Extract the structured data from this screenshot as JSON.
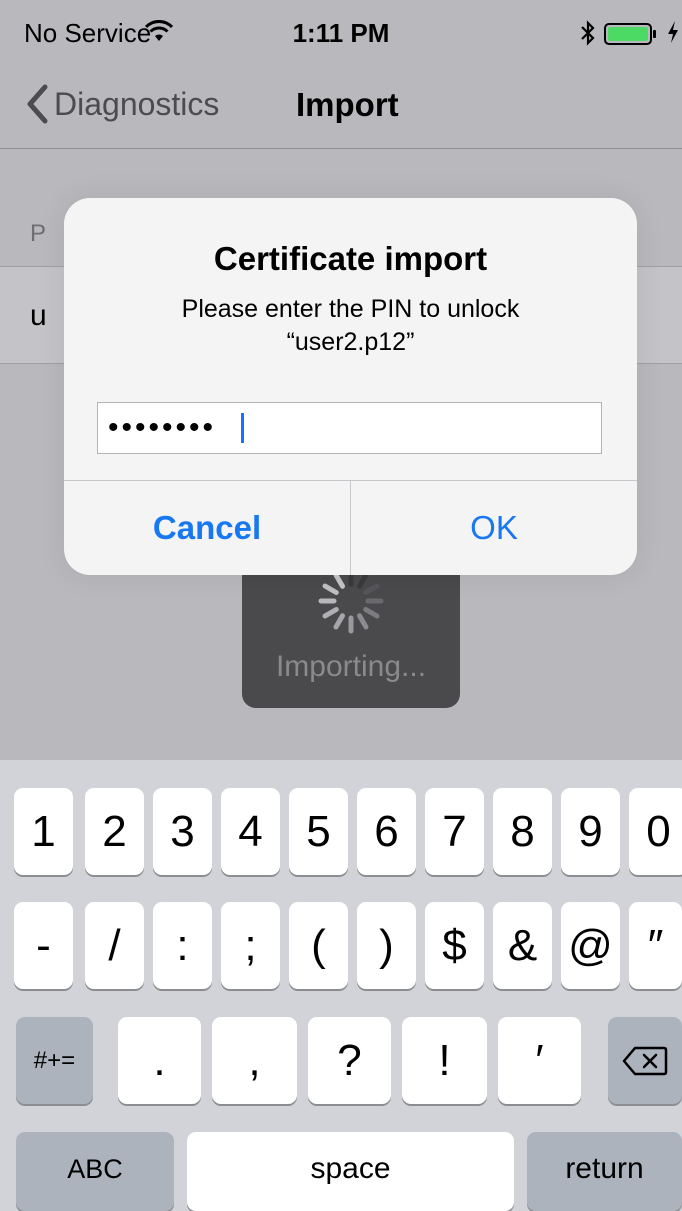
{
  "status_bar": {
    "carrier": "No Service",
    "time": "1:11 PM"
  },
  "nav": {
    "back_label": "Diagnostics",
    "title": "Import"
  },
  "background_list": {
    "section_header": "P",
    "cell_text": "u"
  },
  "alert": {
    "title": "Certificate import",
    "message_line1": "Please enter the PIN to unlock",
    "message_line2": "“user2.p12”",
    "pin_value": "••••••••",
    "cancel_label": "Cancel",
    "ok_label": "OK"
  },
  "hud": {
    "label": "Importing..."
  },
  "keyboard": {
    "row1": [
      "1",
      "2",
      "3",
      "4",
      "5",
      "6",
      "7",
      "8",
      "9",
      "0"
    ],
    "row2": [
      "-",
      "/",
      ":",
      ";",
      "(",
      ")",
      "$",
      "&",
      "@",
      "″"
    ],
    "more_symbols_label": "#+=",
    "row3": [
      ".",
      ",",
      "?",
      "!",
      "′"
    ],
    "abc_label": "ABC",
    "space_label": "space",
    "return_label": "return"
  },
  "colors": {
    "accent": "#1778f2",
    "battery_fill": "#4cd964"
  },
  "icons": [
    "wifi-icon",
    "bluetooth-icon",
    "battery-icon",
    "charging-icon",
    "back-chevron-icon",
    "spinner-icon",
    "delete-icon"
  ]
}
